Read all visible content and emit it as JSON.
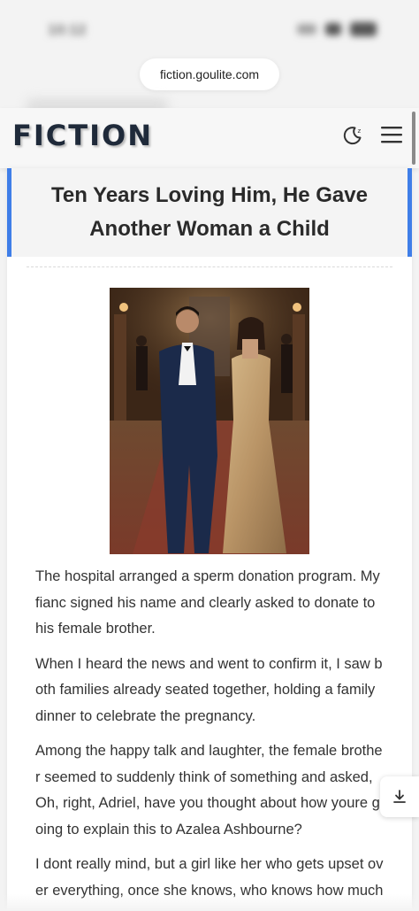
{
  "status_bar": {
    "time": "10:12"
  },
  "browser": {
    "url": "fiction.goulite.com"
  },
  "header": {
    "logo": "FICTION",
    "icons": [
      "moon-icon",
      "menu-icon"
    ]
  },
  "article": {
    "title": "Ten Years Loving Him, He Gave Another Woman a Child",
    "cover_image": "Couple in formal attire: man in navy tuxedo, woman in gold sequined gown, in a grand hall",
    "paragraphs": [
      "The hospital arranged a sperm donation program. My fianc signed his name and clearly asked to donate to his female brother.",
      "When I heard the news and went to confirm it, I saw both families already seated together, holding a family dinner to celebrate the pregnancy.",
      "Among the happy talk and laughter, the female brother seemed to suddenly think of something and asked, Oh, right, Adriel, have you thought about how youre going to explain this to Azalea Ashbourne?",
      "I dont really mind, but a girl like her who gets upset over everything, once she knows, who knows how much t"
    ]
  },
  "floating": {
    "icon": "download-icon"
  },
  "colors": {
    "accent": "#3f7ee8",
    "logo": "#1f2a3a"
  }
}
